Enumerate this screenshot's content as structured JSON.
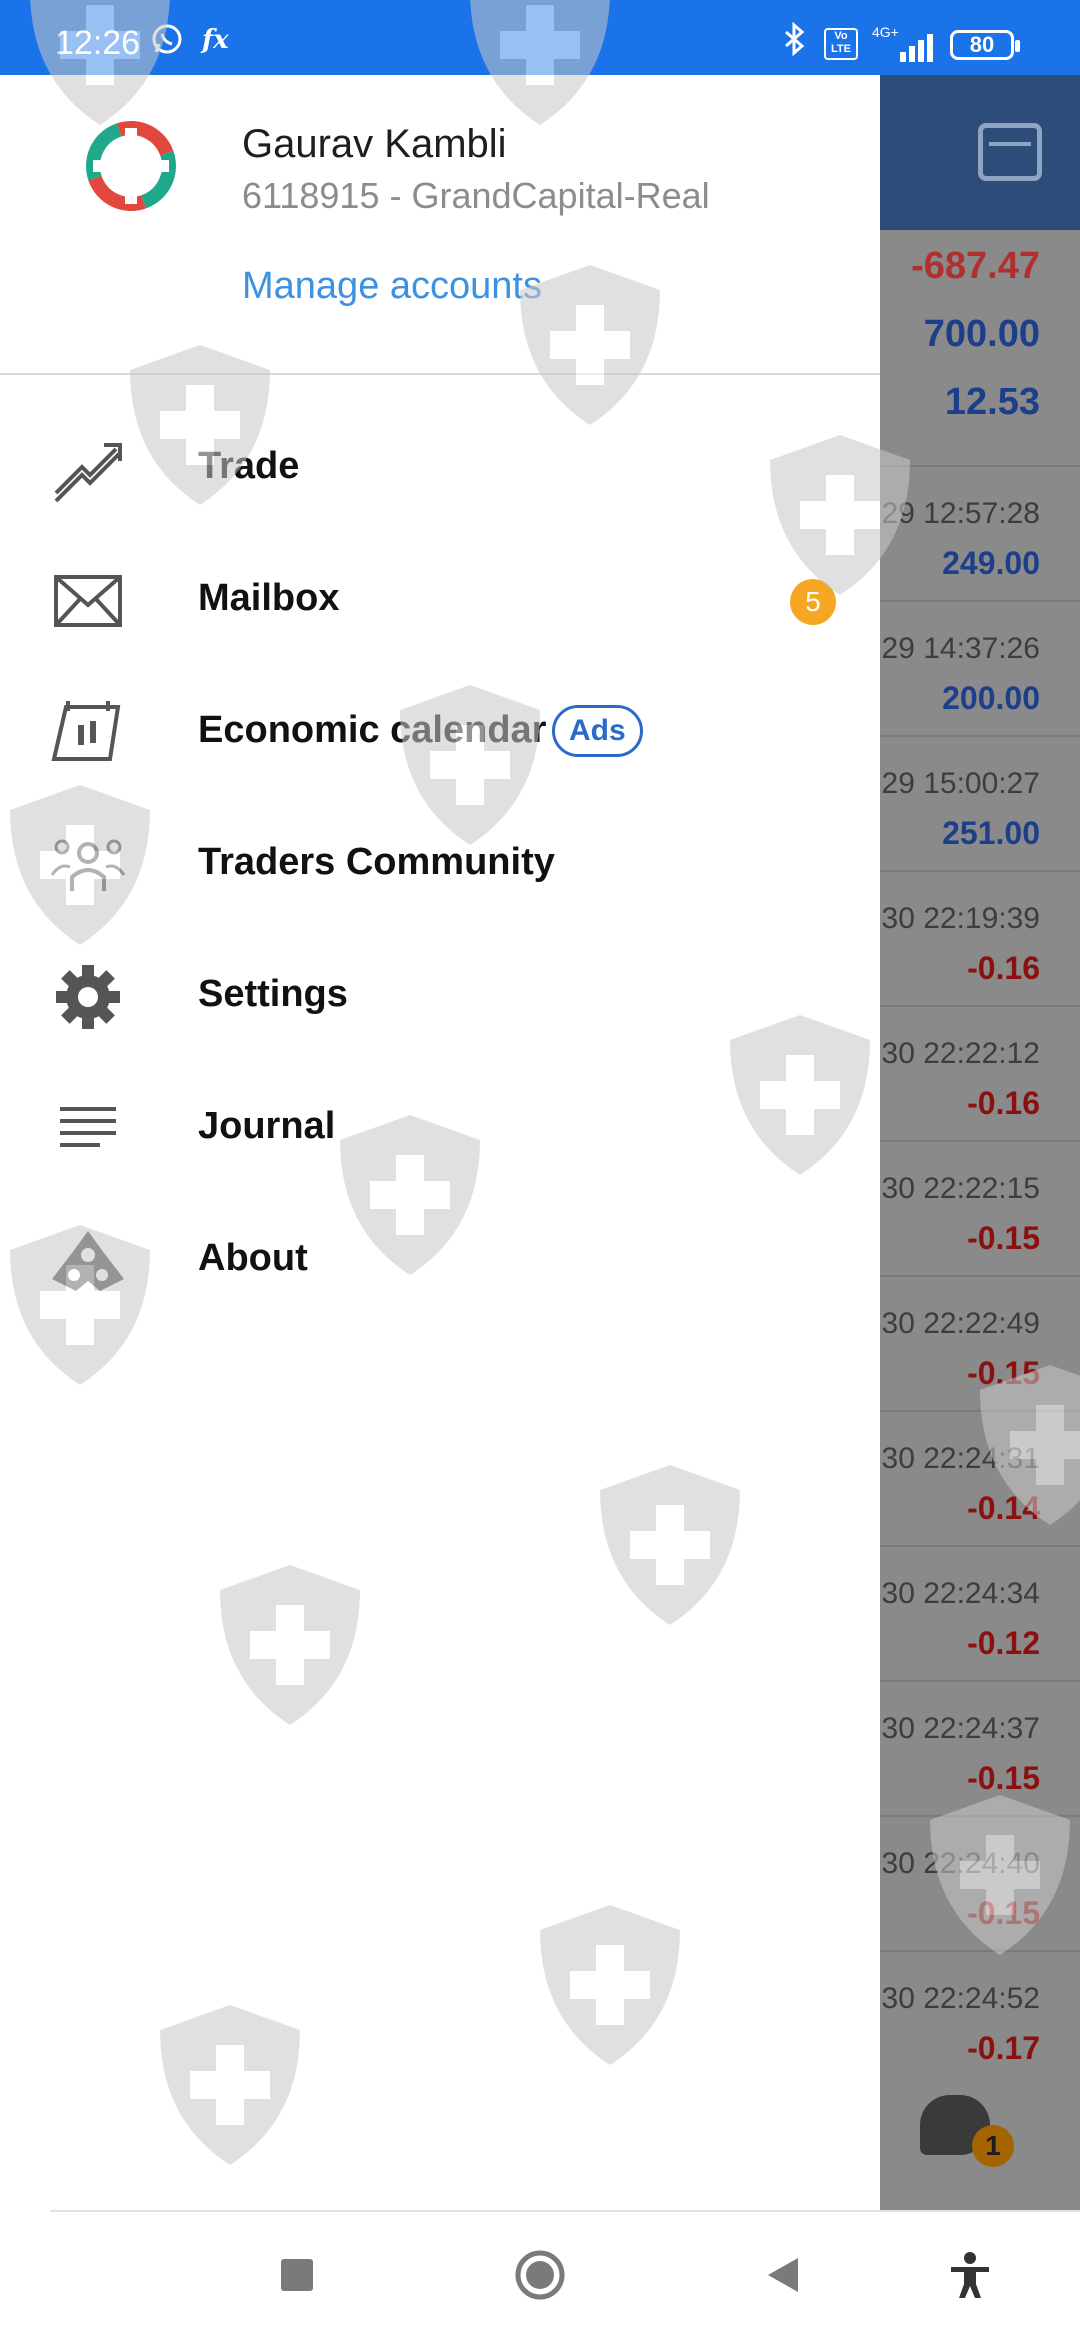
{
  "status_bar": {
    "time": "12:26",
    "battery": "80",
    "network": "4G+",
    "volte": "Vo LTE"
  },
  "drawer": {
    "user_name": "Gaurav Kambli",
    "account": "6118915 - GrandCapital-Real",
    "manage_accounts": "Manage accounts",
    "menu": [
      {
        "label": "Trade",
        "icon": "trade-chart-icon"
      },
      {
        "label": "Mailbox",
        "icon": "envelope-icon",
        "badge": "5"
      },
      {
        "label": "Economic calendar",
        "icon": "calendar-icon",
        "tag": "Ads"
      },
      {
        "label": "Traders Community",
        "icon": "community-icon"
      },
      {
        "label": "Settings",
        "icon": "gear-icon"
      },
      {
        "label": "Journal",
        "icon": "journal-lines-icon"
      },
      {
        "label": "About",
        "icon": "about-logo-icon"
      }
    ]
  },
  "background_app": {
    "summary": [
      {
        "value": "-687.47",
        "color": "#b03030"
      },
      {
        "value": "700.00",
        "color": "#1d3f8a"
      },
      {
        "value": "12.53",
        "color": "#1d3f8a"
      }
    ],
    "deals": [
      {
        "time": ".29 12:57:28",
        "value": "249.00",
        "color": "#1d3f8a"
      },
      {
        "time": ".29 14:37:26",
        "value": "200.00",
        "color": "#1d3f8a"
      },
      {
        "time": ".29 15:00:27",
        "value": "251.00",
        "color": "#1d3f8a"
      },
      {
        "time": ".30 22:19:39",
        "value": "-0.16",
        "color": "#8b1010"
      },
      {
        "time": ".30 22:22:12",
        "value": "-0.16",
        "color": "#8b1010"
      },
      {
        "time": ".30 22:22:15",
        "value": "-0.15",
        "color": "#8b1010"
      },
      {
        "time": ".30 22:22:49",
        "value": "-0.15",
        "color": "#8b1010"
      },
      {
        "time": ".30 22:24:31",
        "value": "-0.14",
        "color": "#8b1010"
      },
      {
        "time": ".30 22:24:34",
        "value": "-0.12",
        "color": "#8b1010"
      },
      {
        "time": ".30 22:24:37",
        "value": "-0.15",
        "color": "#8b1010"
      },
      {
        "time": ".30 22:24:40",
        "value": "-0.15",
        "color": "#8b1010"
      },
      {
        "time": ".30 22:24:52",
        "value": "-0.17",
        "color": "#8b1010"
      }
    ],
    "chat_badge": "1"
  },
  "colors": {
    "accent": "#1a73e8",
    "link": "#3c92e0",
    "badge": "#f5a623"
  }
}
